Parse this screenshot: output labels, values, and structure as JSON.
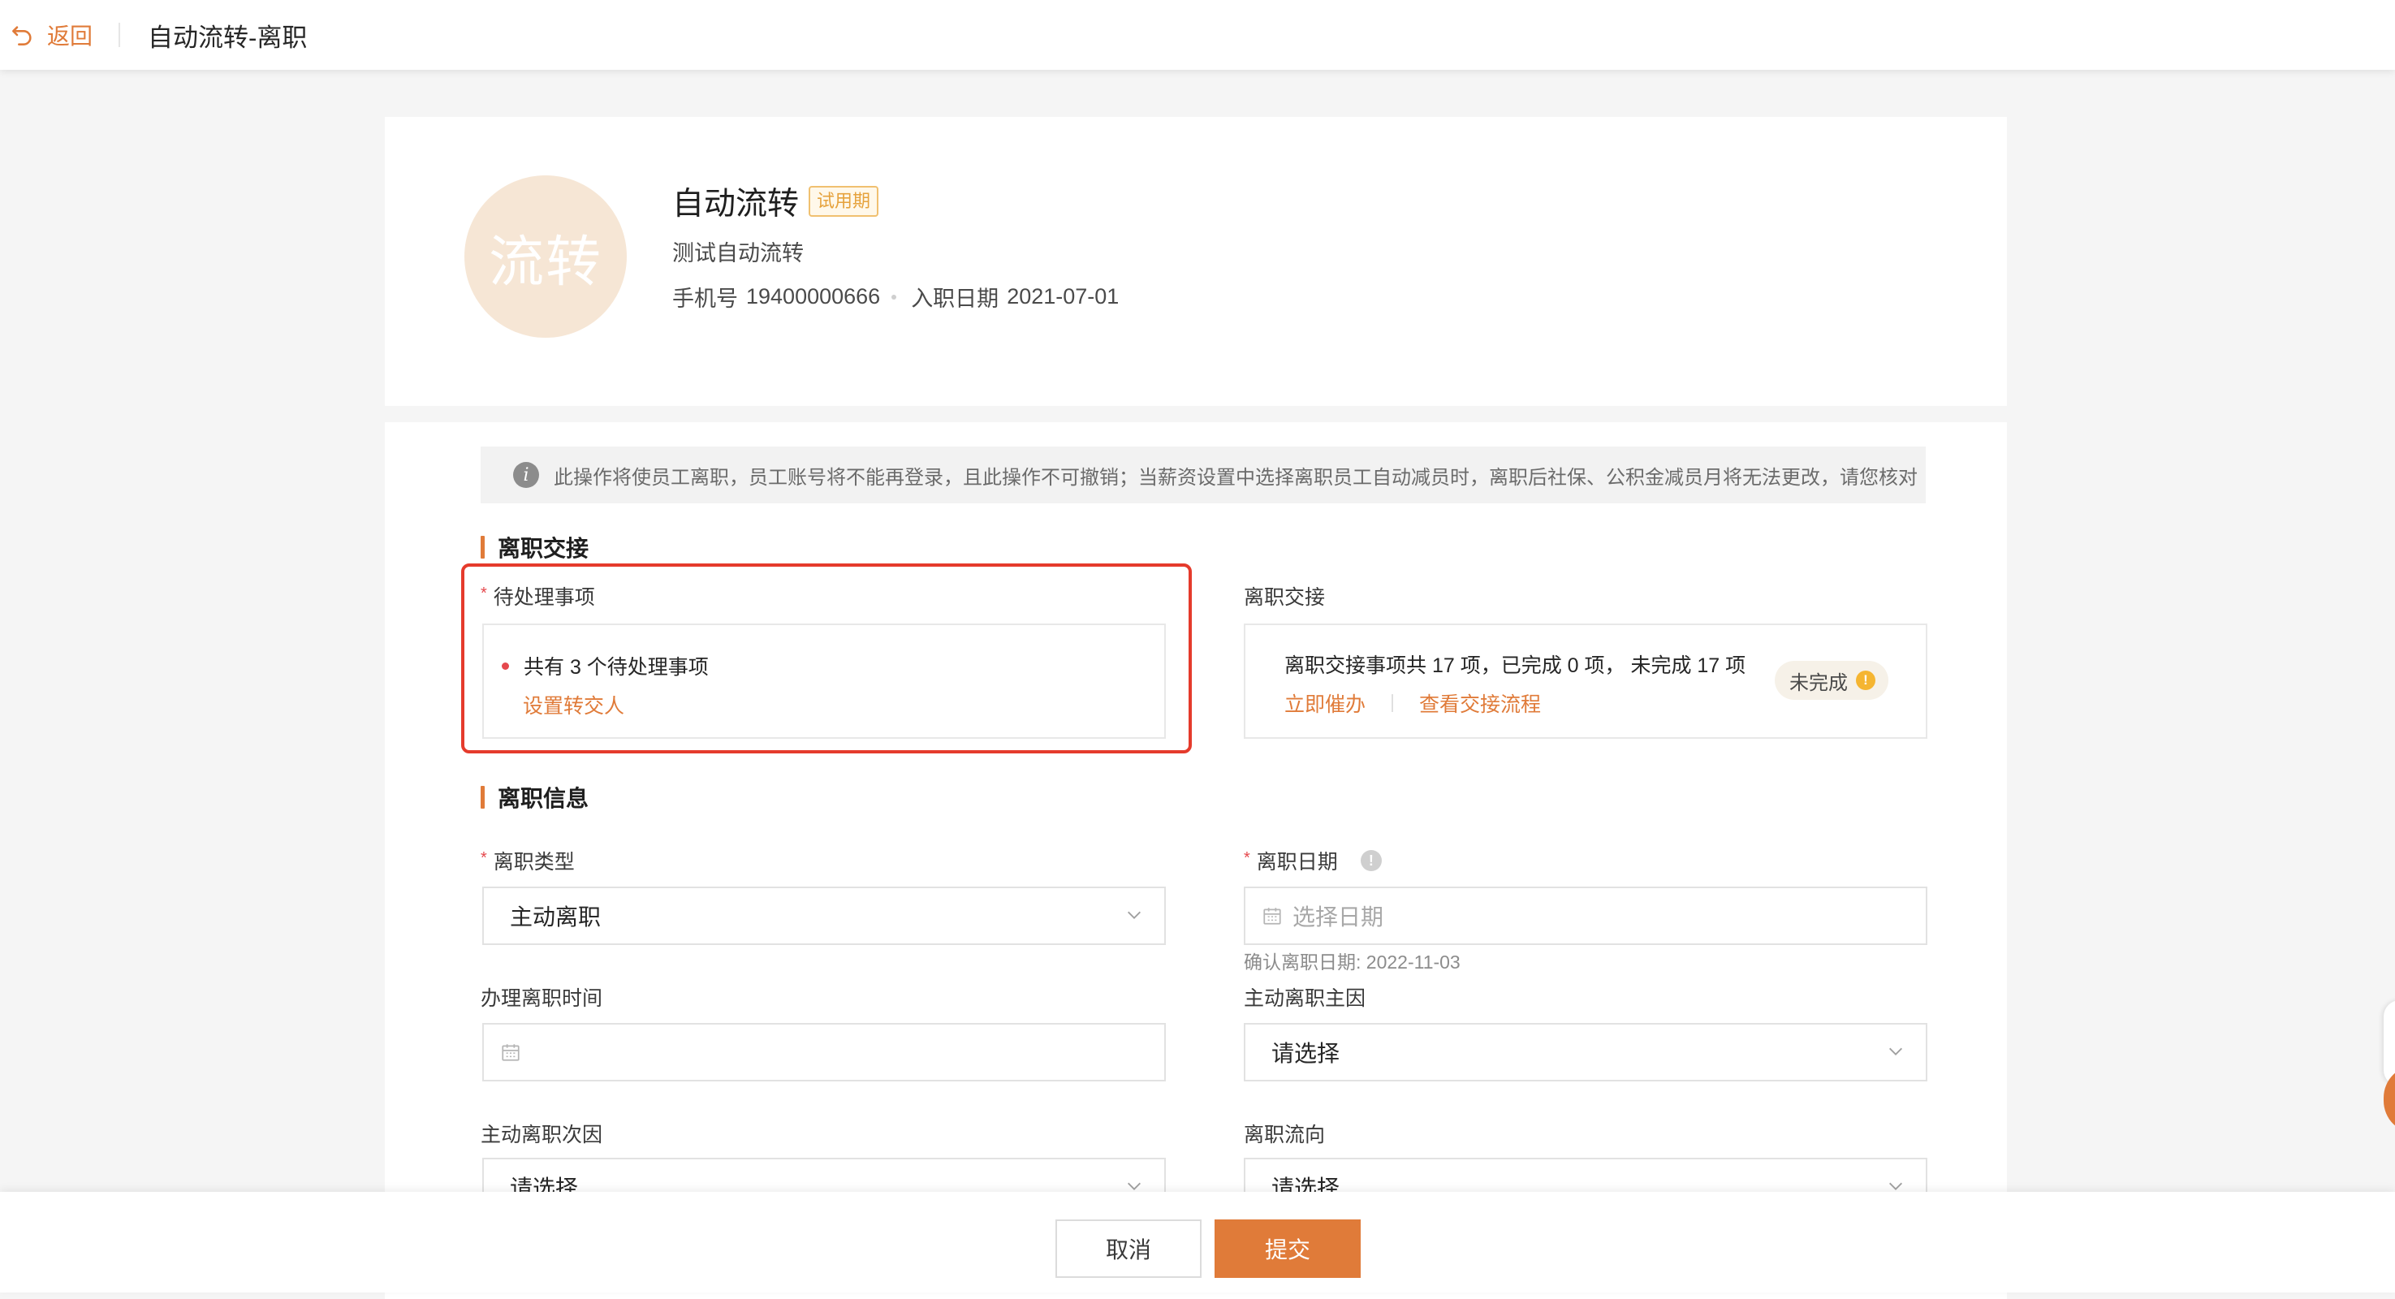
{
  "header": {
    "back_label": "返回",
    "title": "自动流转-离职"
  },
  "profile": {
    "avatar_text": "流转",
    "name": "自动流转",
    "tag": "试用期",
    "description": "测试自动流转",
    "phone_label": "手机号",
    "phone": "19400000666",
    "join_label": "入职日期",
    "join_date": "2021-07-01"
  },
  "notice": {
    "text": "此操作将使员工离职，员工账号将不能再登录，且此操作不可撤销；当薪资设置中选择离职员工自动减员时，离职后社保、公积金减员月将无法更改，请您核对"
  },
  "handover_section": {
    "title": "离职交接",
    "pending": {
      "label": "待处理事项",
      "summary": "共有 3 个待处理事项",
      "link": "设置转交人"
    },
    "handover": {
      "label": "离职交接",
      "summary": "离职交接事项共 17 项，已完成 0 项， 未完成 17 项",
      "link_urge": "立即催办",
      "link_view": "查看交接流程",
      "status": "未完成"
    }
  },
  "info_section": {
    "title": "离职信息",
    "leave_type": {
      "label": "离职类型",
      "value": "主动离职"
    },
    "leave_date": {
      "label": "离职日期",
      "placeholder": "选择日期",
      "hint": "确认离职日期: 2022-11-03"
    },
    "process_time": {
      "label": "办理离职时间",
      "value": ""
    },
    "main_reason": {
      "label": "主动离职主因",
      "placeholder": "请选择"
    },
    "secondary_reason": {
      "label": "主动离职次因",
      "placeholder": "请选择"
    },
    "direction": {
      "label": "离职流向",
      "placeholder": "请选择"
    }
  },
  "footer": {
    "cancel_label": "取消",
    "submit_label": "提交"
  },
  "colors": {
    "accent": "#e07b39",
    "required": "#e5484d",
    "highlight_border": "#e53b2c",
    "tag": "#e6a23c"
  },
  "icons": [
    "back-arrow-icon",
    "info-icon",
    "calendar-icon",
    "chevron-down-icon",
    "question-icon",
    "warning-icon"
  ]
}
